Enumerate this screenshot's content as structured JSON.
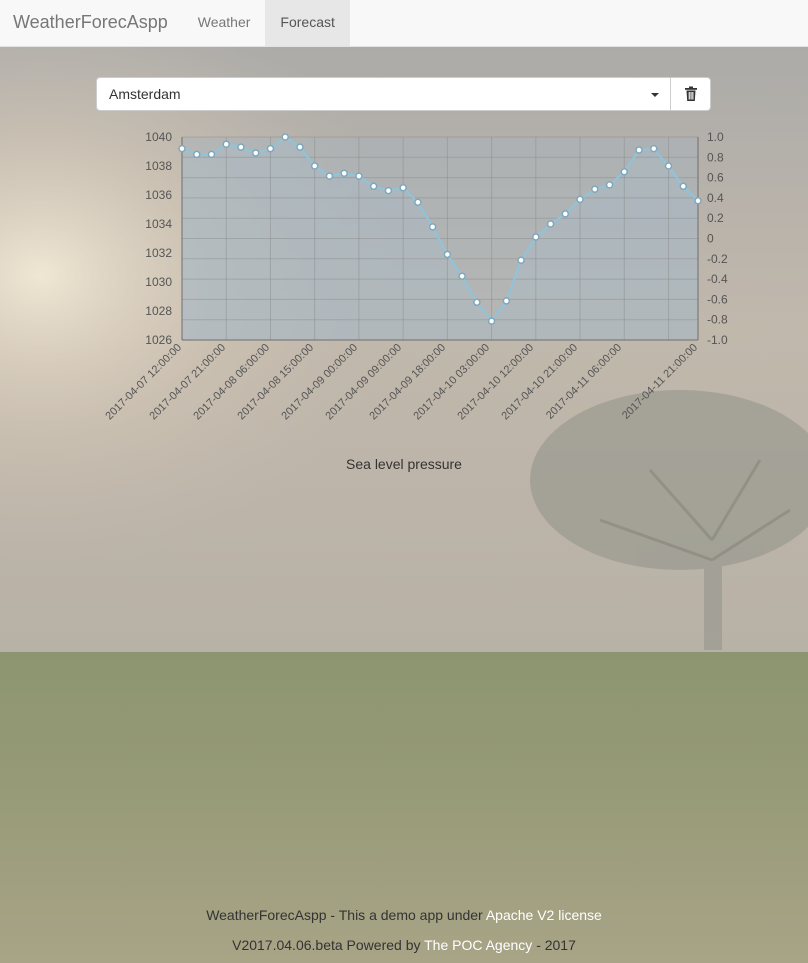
{
  "navbar": {
    "brand": "WeatherForecAspp",
    "items": [
      {
        "label": "Weather",
        "active": false
      },
      {
        "label": "Forecast",
        "active": true
      }
    ]
  },
  "selector": {
    "city": "Amsterdam"
  },
  "chart_caption": "Sea level pressure",
  "chart_data": {
    "type": "line",
    "title": "",
    "xlabel": "",
    "ylabel": "",
    "ylim": [
      1026,
      1040
    ],
    "y2lim": [
      -1.0,
      1.0
    ],
    "y_ticks": [
      "1026",
      "1028",
      "1030",
      "1032",
      "1034",
      "1036",
      "1038",
      "1040"
    ],
    "y2_ticks": [
      "-1.0",
      "-0.8",
      "-0.6",
      "-0.4",
      "-0.2",
      "0",
      "0.2",
      "0.4",
      "0.6",
      "0.8",
      "1.0"
    ],
    "x_tick_labels": [
      "2017-04-07 12:00:00",
      "2017-04-07 21:00:00",
      "2017-04-08 06:00:00",
      "2017-04-08 15:00:00",
      "2017-04-09 00:00:00",
      "2017-04-09 09:00:00",
      "2017-04-09 18:00:00",
      "2017-04-10 03:00:00",
      "2017-04-10 12:00:00",
      "2017-04-10 21:00:00",
      "2017-04-11 06:00:00",
      "2017-04-11 21:00:00"
    ],
    "grid": true,
    "series": [
      {
        "color": "#8ec4dc",
        "values": [
          1039.2,
          1038.8,
          1038.8,
          1039.5,
          1039.3,
          1038.9,
          1039.2,
          1040.0,
          1039.3,
          1038.0,
          1037.3,
          1037.5,
          1037.3,
          1036.6,
          1036.3,
          1036.5,
          1035.5,
          1033.8,
          1031.9,
          1030.4,
          1028.6,
          1027.3,
          1028.7,
          1031.5,
          1033.1,
          1034.0,
          1034.7,
          1035.7,
          1036.4,
          1036.7,
          1037.6,
          1039.1,
          1039.2,
          1038.0,
          1036.6,
          1035.6
        ]
      }
    ]
  },
  "footer": {
    "line1_text": "WeatherForecAspp - This a demo app under",
    "line1_link": "Apache V2 license",
    "line2_text": "V2017.04.06.beta Powered by",
    "line2_link": "The POC Agency",
    "line2_suffix": "- 2017"
  }
}
